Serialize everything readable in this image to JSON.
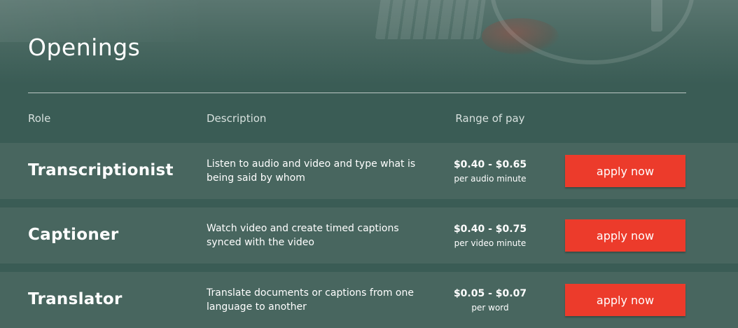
{
  "page": {
    "title": "Openings"
  },
  "table": {
    "headers": {
      "role": "Role",
      "description": "Description",
      "pay": "Range of pay"
    },
    "rows": [
      {
        "role": "Transcriptionist",
        "description": "Listen to audio and video and type what is being said by whom",
        "pay_range": "$0.40 - $0.65",
        "pay_unit": "per audio minute",
        "button_label": "apply now"
      },
      {
        "role": "Captioner",
        "description": "Watch video and create timed captions synced with the video",
        "pay_range": "$0.40 - $0.75",
        "pay_unit": "per video minute",
        "button_label": "apply now"
      },
      {
        "role": "Translator",
        "description": "Translate documents or captions from one language to another",
        "pay_range": "$0.05 - $0.07",
        "pay_unit": "per word",
        "button_label": "apply now"
      }
    ]
  },
  "colors": {
    "background": "#3a5c55",
    "row_background": "#48665f",
    "button": "#ec3b2b",
    "text": "#ffffff"
  }
}
